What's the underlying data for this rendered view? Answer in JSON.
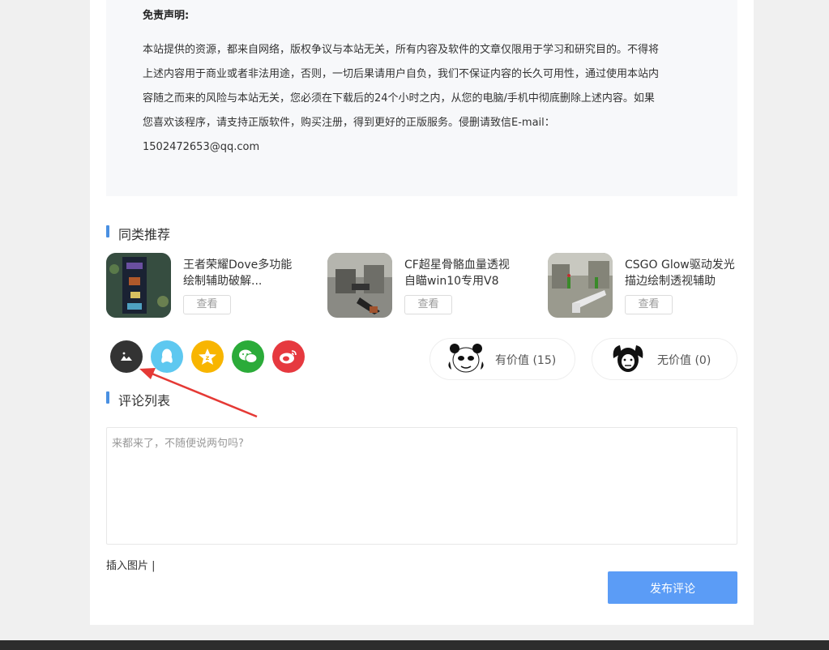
{
  "disclaimer": {
    "title": "免责声明:",
    "lines": [
      "本站提供的资源，都来自网络，版权争议与本站无关，所有内容及软件的文章仅限用于学习和研究目的。不得将",
      "上述内容用于商业或者非法用途，否则，一切后果请用户自负，我们不保证内容的长久可用性，通过使用本站内",
      "容随之而来的风险与本站无关，您必须在下载后的24个小时之内，从您的电脑/手机中彻底删除上述内容。如果",
      "您喜欢该程序，请支持正版软件，购买注册，得到更好的正版服务。侵删请致信E-mail：",
      "1502472653@qq.com"
    ]
  },
  "recommend": {
    "title": "同类推荐",
    "items": [
      {
        "title": "王者荣耀Dove多功能绘制辅助破解...",
        "button": "查看"
      },
      {
        "title": "CF超星骨骼血量透视自瞄win10专用V8",
        "button": "查看"
      },
      {
        "title": "CSGO Glow驱动发光描边绘制透视辅助",
        "button": "查看"
      }
    ]
  },
  "share": {
    "icons": [
      {
        "name": "poster-icon",
        "color": "#333333"
      },
      {
        "name": "qq-icon",
        "color": "#5ec8f0"
      },
      {
        "name": "qzone-icon",
        "color": "#f8b500"
      },
      {
        "name": "wechat-icon",
        "color": "#2bab39"
      },
      {
        "name": "weibo-icon",
        "color": "#e6393f"
      }
    ]
  },
  "votes": {
    "valuable": "有价值 (15)",
    "not_valuable": "无价值 (0)"
  },
  "comments": {
    "title": "评论列表",
    "placeholder": "来都来了，不随便说两句吗?",
    "insert_image": "插入图片 |",
    "submit": "发布评论"
  },
  "colors": {
    "accent": "#4a90e2",
    "submit_button": "#5b9cf6",
    "annotation_arrow": "#e53935"
  }
}
